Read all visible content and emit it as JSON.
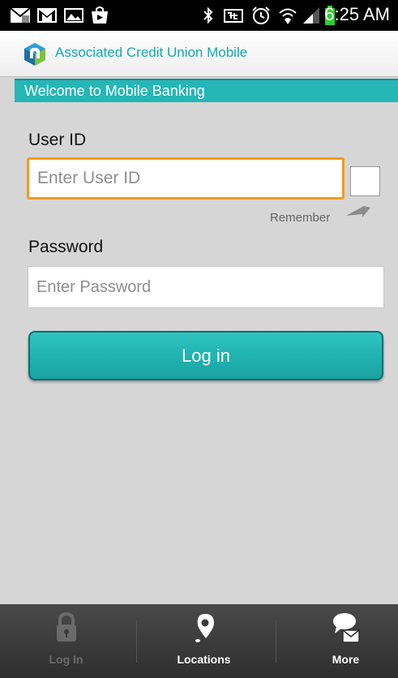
{
  "status_bar": {
    "time": "6:25 AM",
    "icons": [
      "email-icon",
      "gmail-icon",
      "gallery-icon",
      "play-store-icon",
      "bluetooth-icon",
      "nfc-icon",
      "alarm-icon",
      "wifi-icon",
      "signal-icon",
      "battery-icon"
    ]
  },
  "header": {
    "title": "Associated Credit Union Mobile",
    "accent_color": "#15a8b3"
  },
  "banner": {
    "text": "Welcome to Mobile Banking",
    "color": "#25b6b6"
  },
  "form": {
    "user_id_label": "User ID",
    "user_id_placeholder": "Enter User ID",
    "user_id_value": "",
    "remember_label": "Remember",
    "remember_checked": false,
    "password_label": "Password",
    "password_placeholder": "Enter Password",
    "password_value": "",
    "login_label": "Log in"
  },
  "bottom_nav": {
    "items": [
      {
        "label": "Log In",
        "icon": "lock-icon",
        "active": false
      },
      {
        "label": "Locations",
        "icon": "map-pin-icon",
        "active": true
      },
      {
        "label": "More",
        "icon": "chat-mail-icon",
        "active": true
      }
    ]
  }
}
